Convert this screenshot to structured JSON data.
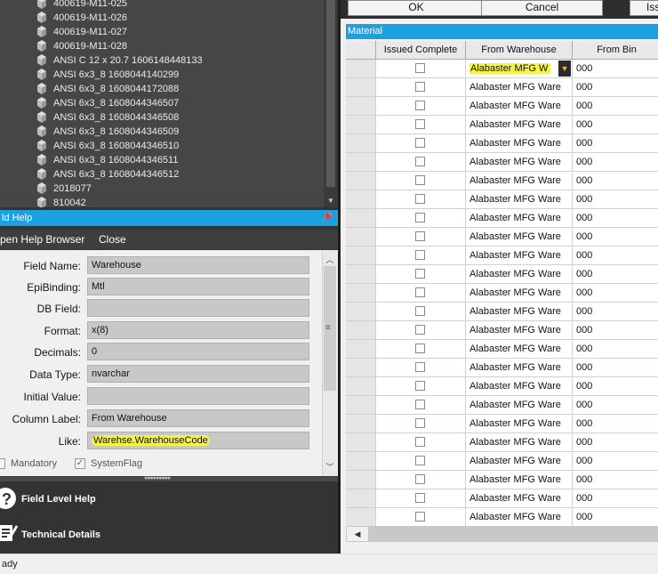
{
  "tree": {
    "items": [
      "400619-M11-025",
      "400619-M11-026",
      "400619-M11-027",
      "400619-M11-028",
      "ANSI C 12 x 20.7 1606148448133",
      "ANSI 6x3_8 1608044140299",
      "ANSI 6x3_8 1608044172088",
      "ANSI 6x3_8 1608044346507",
      "ANSI 6x3_8 1608044346508",
      "ANSI 6x3_8 1608044346509",
      "ANSI 6x3_8 1608044346510",
      "ANSI 6x3_8 1608044346511",
      "ANSI 6x3_8 1608044346512",
      "2018077",
      "810042"
    ],
    "icon": "parts-stack-icon"
  },
  "field_help": {
    "title": "ld Help",
    "toolbar": {
      "open_help": "pen Help Browser",
      "close": "Close"
    },
    "fields": [
      {
        "label": "Field Name:",
        "value": "Warehouse"
      },
      {
        "label": "EpiBinding:",
        "value": "Mtl"
      },
      {
        "label": "DB Field:",
        "value": ""
      },
      {
        "label": "Format:",
        "value": "x(8)"
      },
      {
        "label": "Decimals:",
        "value": "0"
      },
      {
        "label": "Data Type:",
        "value": "nvarchar"
      },
      {
        "label": "Initial Value:",
        "value": ""
      },
      {
        "label": "Column Label:",
        "value": "From Warehouse"
      },
      {
        "label": "Like:",
        "value": "Warehse.WarehouseCode"
      }
    ],
    "mandatory": {
      "label": "Mandatory",
      "checked": false
    },
    "system_flag": {
      "label": "SystemFlag",
      "checked": true
    }
  },
  "nav": {
    "field_level_help": "Field Level Help",
    "technical_details": "Technical Details"
  },
  "buttons": {
    "ok": "OK",
    "cancel": "Cancel",
    "issue": "Iss"
  },
  "material": {
    "title": "Material",
    "columns": [
      "Issued Complete",
      "From Warehouse",
      "From Bin"
    ],
    "rows": [
      {
        "issued": false,
        "warehouse": "Alabaster MFG W",
        "bin": "000"
      },
      {
        "issued": false,
        "warehouse": "Alabaster MFG Ware",
        "bin": "000"
      },
      {
        "issued": false,
        "warehouse": "Alabaster MFG Ware",
        "bin": "000"
      },
      {
        "issued": false,
        "warehouse": "Alabaster MFG Ware",
        "bin": "000"
      },
      {
        "issued": false,
        "warehouse": "Alabaster MFG Ware",
        "bin": "000"
      },
      {
        "issued": false,
        "warehouse": "Alabaster MFG Ware",
        "bin": "000"
      },
      {
        "issued": false,
        "warehouse": "Alabaster MFG Ware",
        "bin": "000"
      },
      {
        "issued": false,
        "warehouse": "Alabaster MFG Ware",
        "bin": "000"
      },
      {
        "issued": false,
        "warehouse": "Alabaster MFG Ware",
        "bin": "000"
      },
      {
        "issued": false,
        "warehouse": "Alabaster MFG Ware",
        "bin": "000"
      },
      {
        "issued": false,
        "warehouse": "Alabaster MFG Ware",
        "bin": "000"
      },
      {
        "issued": false,
        "warehouse": "Alabaster MFG Ware",
        "bin": "000"
      },
      {
        "issued": false,
        "warehouse": "Alabaster MFG Ware",
        "bin": "000"
      },
      {
        "issued": false,
        "warehouse": "Alabaster MFG Ware",
        "bin": "000"
      },
      {
        "issued": false,
        "warehouse": "Alabaster MFG Ware",
        "bin": "000"
      },
      {
        "issued": false,
        "warehouse": "Alabaster MFG Ware",
        "bin": "000"
      },
      {
        "issued": false,
        "warehouse": "Alabaster MFG Ware",
        "bin": "000"
      },
      {
        "issued": false,
        "warehouse": "Alabaster MFG Ware",
        "bin": "000"
      },
      {
        "issued": false,
        "warehouse": "Alabaster MFG Ware",
        "bin": "000"
      },
      {
        "issued": false,
        "warehouse": "Alabaster MFG Ware",
        "bin": "000"
      },
      {
        "issued": false,
        "warehouse": "Alabaster MFG Ware",
        "bin": "000"
      },
      {
        "issued": false,
        "warehouse": "Alabaster MFG Ware",
        "bin": "000"
      },
      {
        "issued": false,
        "warehouse": "Alabaster MFG Ware",
        "bin": "000"
      },
      {
        "issued": false,
        "warehouse": "Alabaster MFG Ware",
        "bin": "000"
      },
      {
        "issued": false,
        "warehouse": "Alabaster MFG Ware",
        "bin": "000"
      }
    ]
  },
  "status": {
    "text": "ady"
  },
  "colors": {
    "accent": "#1ba1e2",
    "highlight": "#f5f34a",
    "dark": "#333333"
  }
}
